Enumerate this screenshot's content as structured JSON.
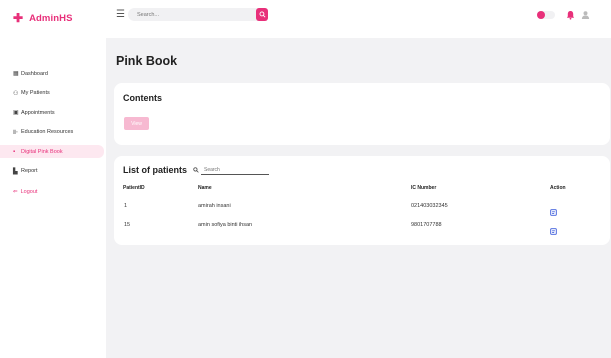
{
  "brand": {
    "name": "AdminHS"
  },
  "header": {
    "search_placeholder": "Search...",
    "theme_toggle_on": true
  },
  "sidebar": {
    "items": [
      {
        "label": "Dashboard",
        "icon": "grid-icon",
        "active": false
      },
      {
        "label": "My Patients",
        "icon": "people-icon",
        "active": false
      },
      {
        "label": "Appointments",
        "icon": "calendar-icon",
        "active": false
      },
      {
        "label": "Education Resources",
        "icon": "book-icon",
        "active": false
      },
      {
        "label": "Digital Pink Book",
        "icon": "pink-book-icon",
        "active": true
      },
      {
        "label": "Report",
        "icon": "report-icon",
        "active": false
      }
    ],
    "logout_label": "Logout"
  },
  "main": {
    "page_title": "Pink Book",
    "contents": {
      "title": "Contents",
      "view_button_label": "View"
    },
    "patients": {
      "title": "List of patients",
      "search_placeholder": "Search",
      "columns": [
        "PatientID",
        "Name",
        "IC Number",
        "Action"
      ],
      "rows": [
        {
          "id": "1",
          "name": "amirah insani",
          "ic": "021403032345"
        },
        {
          "id": "15",
          "name": "amin sofiya binti ihsan",
          "ic": "9801707788"
        }
      ]
    }
  },
  "colors": {
    "accent": "#e8307a",
    "accent_light": "#f7b9d1",
    "active_bg": "#fde8f0",
    "main_bg": "#f2f2f4"
  }
}
